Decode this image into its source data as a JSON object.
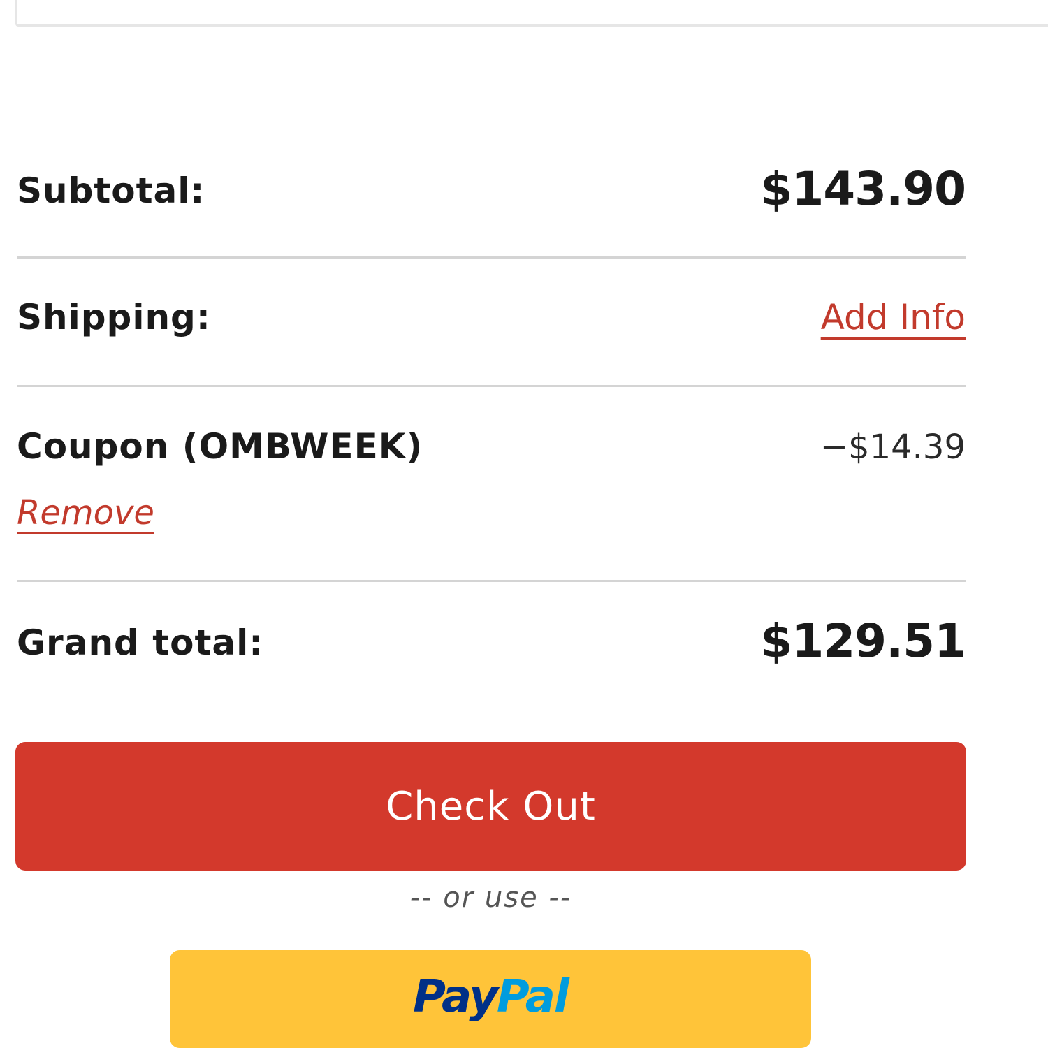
{
  "summary": {
    "subtotal": {
      "label": "Subtotal:",
      "value": "$143.90"
    },
    "shipping": {
      "label": "Shipping:",
      "action": "Add Info"
    },
    "coupon": {
      "label": "Coupon (OMBWEEK)",
      "value": "−$14.39",
      "remove_label": "Remove"
    },
    "grand_total": {
      "label": "Grand total:",
      "value": "$129.51"
    }
  },
  "actions": {
    "checkout_label": "Check Out",
    "or_use_label": "-- or use --",
    "paypal": {
      "part1": "Pay",
      "part2": "Pal"
    }
  },
  "colors": {
    "accent_red": "#d3392c",
    "link_red": "#c23a2c",
    "paypal_yellow": "#ffc439",
    "paypal_dark_blue": "#003087",
    "paypal_light_blue": "#009cde",
    "divider": "#d4d4d4"
  }
}
